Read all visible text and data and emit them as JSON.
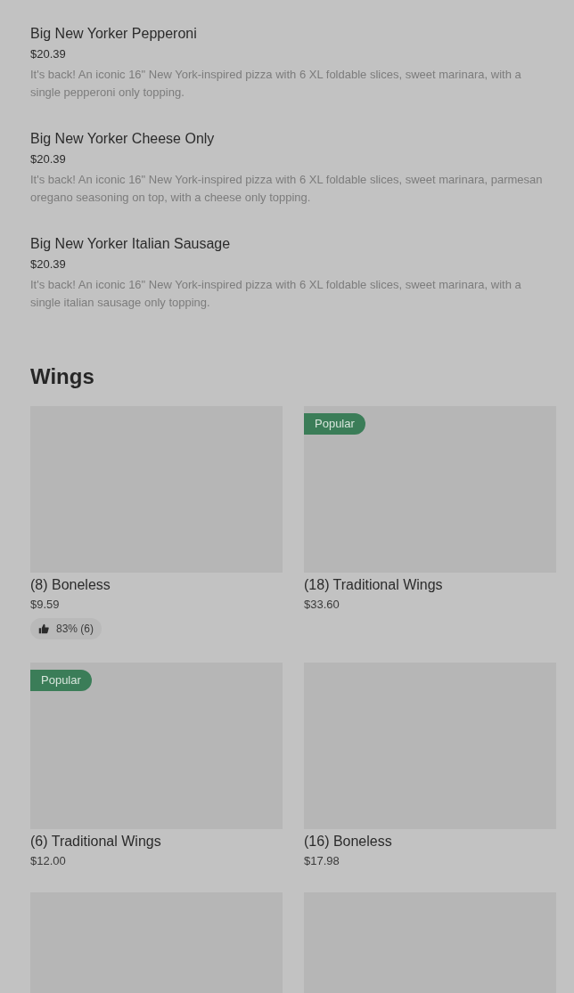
{
  "menu_items": [
    {
      "name": "Big New Yorker Pepperoni",
      "price": "$20.39",
      "description": "It's back! An iconic 16\" New York-inspired pizza with 6 XL foldable slices, sweet marinara, with a single pepperoni only topping."
    },
    {
      "name": "Big New Yorker Cheese Only",
      "price": "$20.39",
      "description": "It's back! An iconic 16\" New York-inspired pizza with 6 XL foldable slices, sweet marinara, parmesan oregano seasoning on top, with a cheese only topping."
    },
    {
      "name": "Big New Yorker Italian Sausage",
      "price": "$20.39",
      "description": "It's back! An iconic 16\" New York-inspired pizza with 6 XL foldable slices, sweet marinara, with a single italian sausage only topping."
    }
  ],
  "section": {
    "title": "Wings",
    "items": [
      {
        "name": "(8) Boneless",
        "price": "$9.59",
        "popular": false,
        "rating": "83% (6)"
      },
      {
        "name": "(18) Traditional Wings",
        "price": "$33.60",
        "popular": true,
        "badge": "Popular"
      },
      {
        "name": "(6) Traditional Wings",
        "price": "$12.00",
        "popular": true,
        "badge": "Popular"
      },
      {
        "name": "(16) Boneless",
        "price": "$17.98",
        "popular": false
      },
      {
        "popular": false
      },
      {
        "popular": false
      }
    ]
  }
}
